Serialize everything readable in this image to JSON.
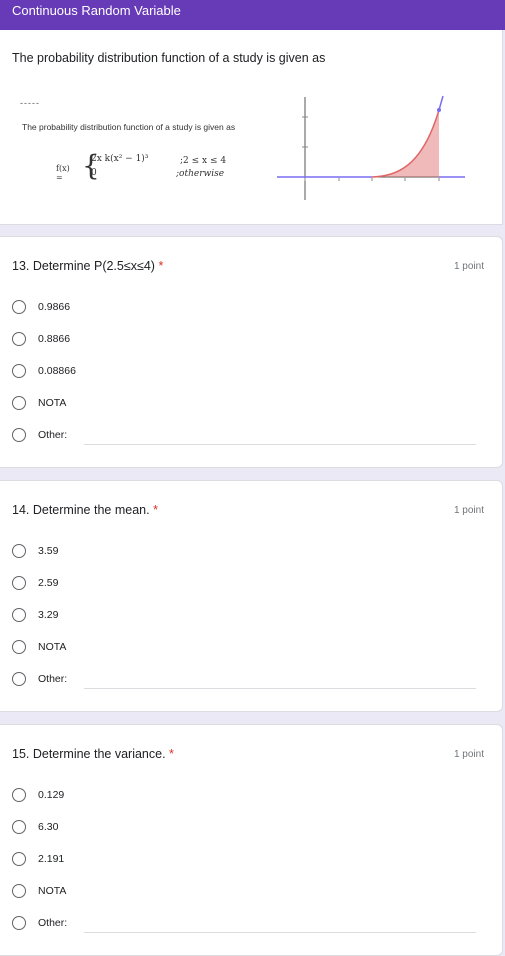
{
  "header": {
    "title": "Continuous Random Variable"
  },
  "section": {
    "description": "The probability distribution function of a study is given as",
    "image": {
      "dashes": "-----",
      "caption": "The probability distribution function of a study is given as",
      "fx": "f(x) =",
      "case1": "2x k(x² − 1)³",
      "case2": "0",
      "cond1": ";2 ≤ x ≤ 4",
      "cond2": ";otherwise"
    }
  },
  "questions": [
    {
      "title": "13. Determine P(2.5≤x≤4)",
      "required_mark": "*",
      "points": "1 point",
      "options": [
        "0.9866",
        "0.8866",
        "0.08866",
        "NOTA"
      ],
      "other_label": "Other:"
    },
    {
      "title": "14. Determine the mean.",
      "required_mark": "*",
      "points": "1 point",
      "options": [
        "3.59",
        "2.59",
        "3.29",
        "NOTA"
      ],
      "other_label": "Other:"
    },
    {
      "title": "15. Determine the variance.",
      "required_mark": "*",
      "points": "1 point",
      "options": [
        "0.129",
        "6.30",
        "2.191",
        "NOTA"
      ],
      "other_label": "Other:"
    }
  ],
  "colors": {
    "accent": "#673ab7",
    "required": "#d93025",
    "curve": "#e06666",
    "axis_line": "#7a6cf0"
  }
}
